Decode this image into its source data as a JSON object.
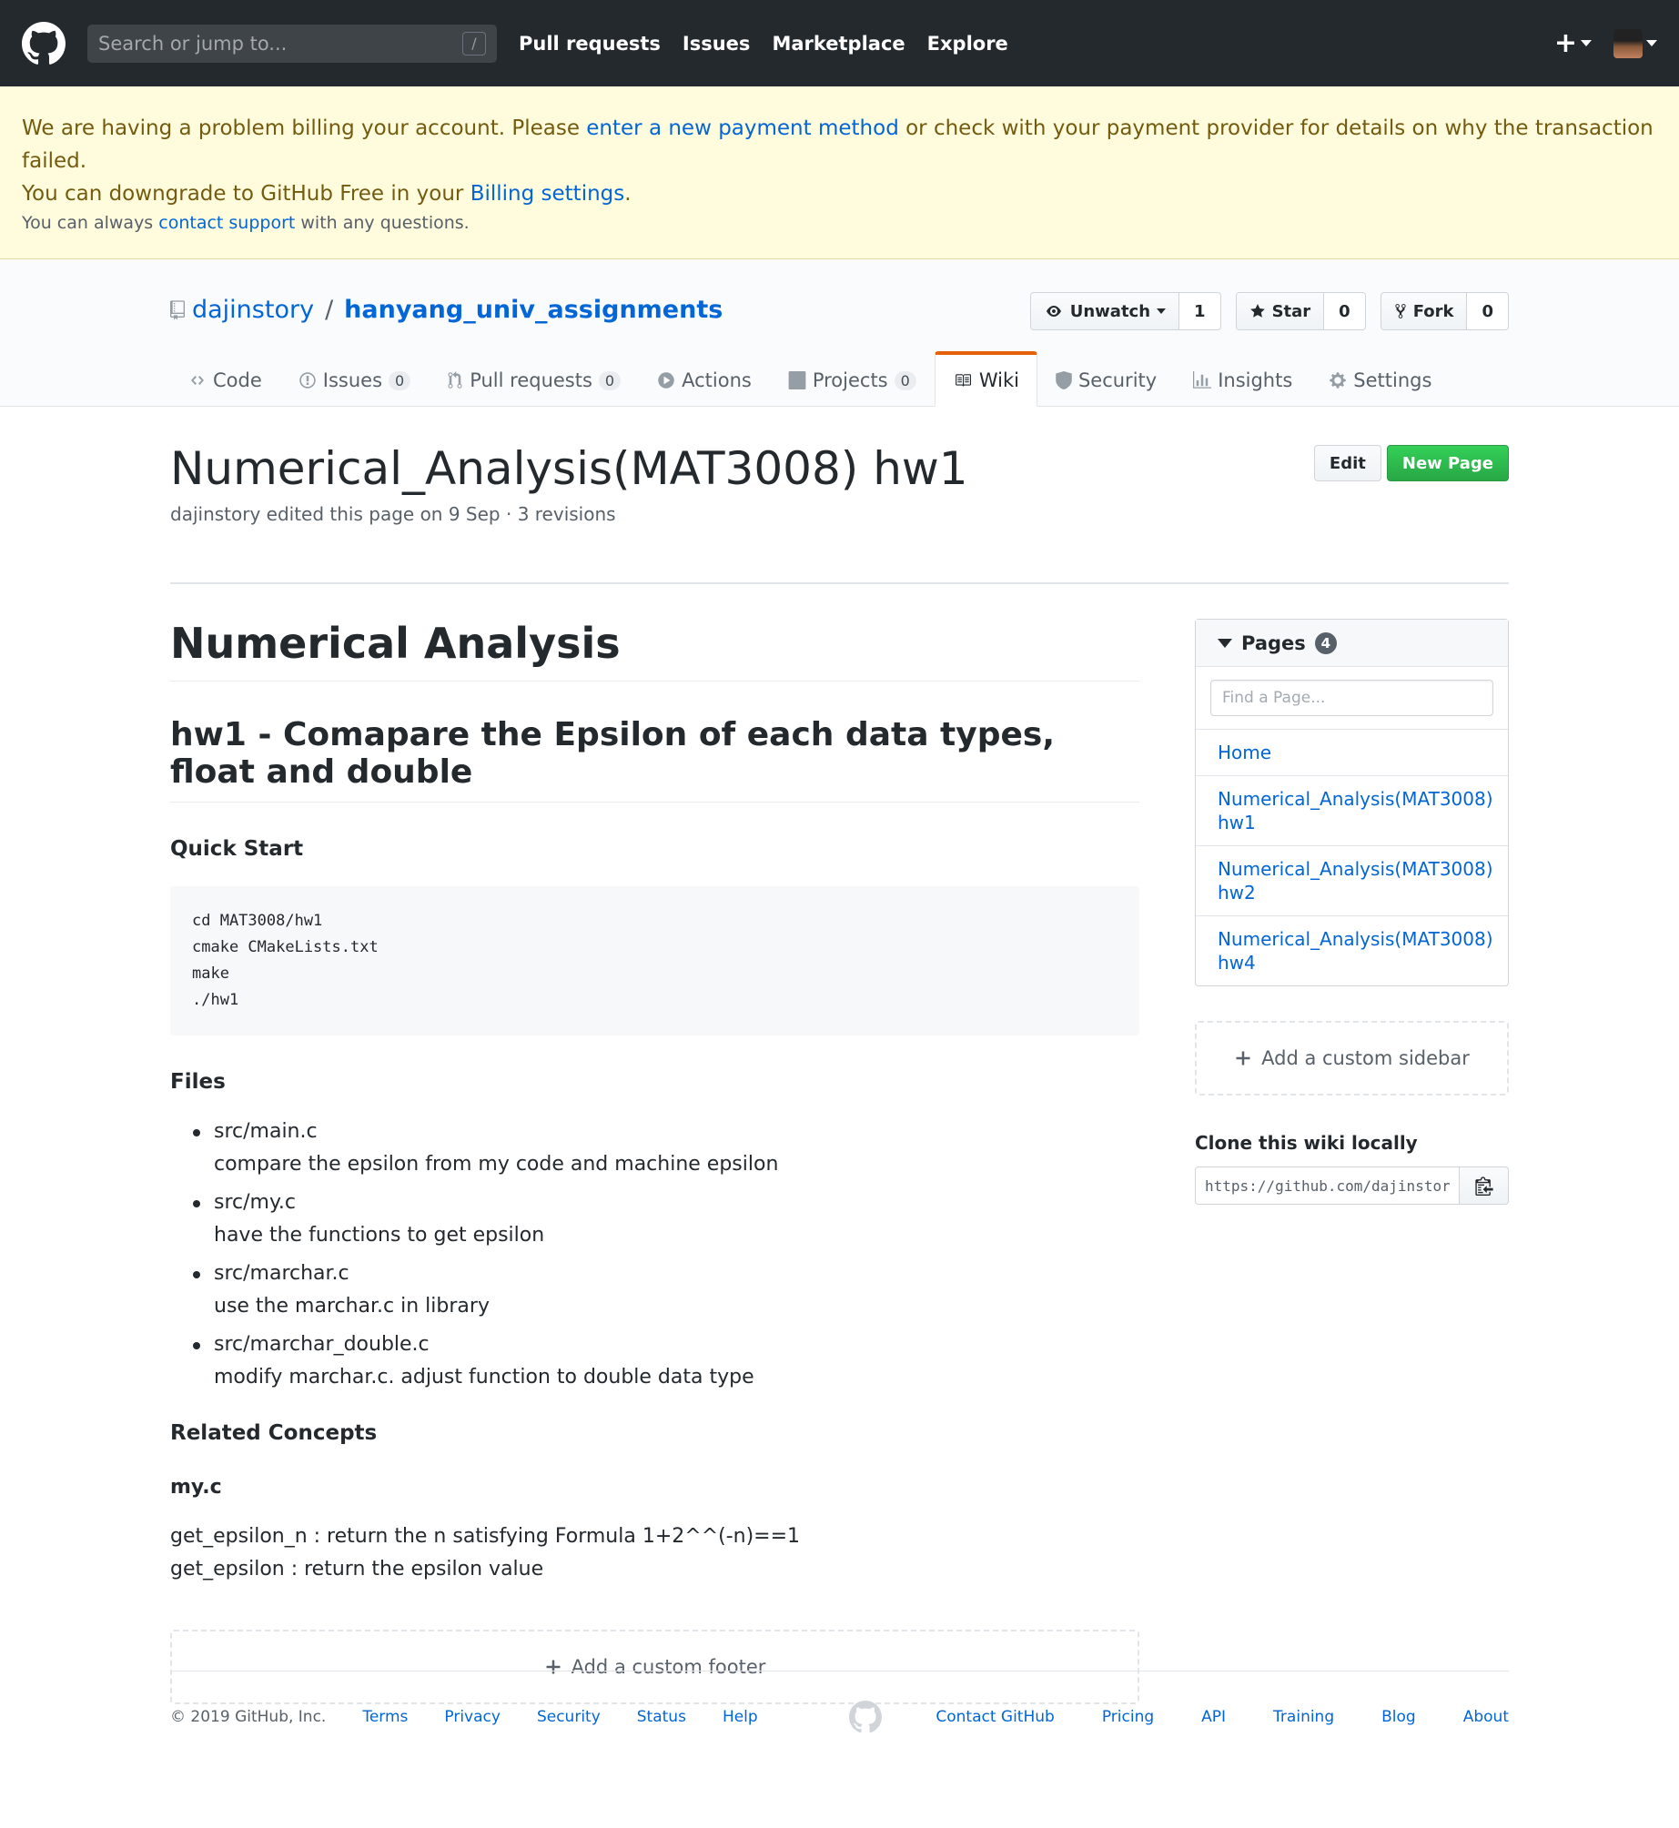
{
  "header": {
    "search_placeholder": "Search or jump to...",
    "slash_key": "/",
    "nav": [
      "Pull requests",
      "Issues",
      "Marketplace",
      "Explore"
    ],
    "new_symbol": "+"
  },
  "banner": {
    "line1_pre": "We are having a problem billing your account. Please ",
    "line1_link": "enter a new payment method",
    "line1_post": " or check with your payment provider for details on why the transaction failed.",
    "line2_pre": "You can downgrade to GitHub Free in your ",
    "line2_link": "Billing settings",
    "line2_post": ".",
    "line3_pre": "You can always ",
    "line3_link": "contact support",
    "line3_post": " with any questions."
  },
  "repo": {
    "owner": "dajinstory",
    "separator": "/",
    "name": "hanyang_univ_assignments",
    "watch_label": "Unwatch",
    "watch_count": "1",
    "star_label": "Star",
    "star_count": "0",
    "fork_label": "Fork",
    "fork_count": "0",
    "tabs": [
      {
        "label": "Code",
        "count": ""
      },
      {
        "label": "Issues",
        "count": "0"
      },
      {
        "label": "Pull requests",
        "count": "0"
      },
      {
        "label": "Actions",
        "count": ""
      },
      {
        "label": "Projects",
        "count": "0"
      },
      {
        "label": "Wiki",
        "count": ""
      },
      {
        "label": "Security",
        "count": ""
      },
      {
        "label": "Insights",
        "count": ""
      },
      {
        "label": "Settings",
        "count": ""
      }
    ]
  },
  "wiki": {
    "title": "Numerical_Analysis(MAT3008) hw1",
    "meta": "dajinstory edited this page on 9 Sep · 3 revisions",
    "edit_label": "Edit",
    "new_page_label": "New Page"
  },
  "content": {
    "h1": "Numerical Analysis",
    "h2": "hw1 - Comapare the Epsilon of each data types, float and double",
    "quick_start": "Quick Start",
    "code": "cd MAT3008/hw1\ncmake CMakeLists.txt\nmake\n./hw1",
    "files_heading": "Files",
    "files": [
      {
        "name": "src/main.c",
        "desc": "compare the epsilon from my code and machine epsilon"
      },
      {
        "name": "src/my.c",
        "desc": "have the functions to get epsilon"
      },
      {
        "name": "src/marchar.c",
        "desc": "use the marchar.c in library"
      },
      {
        "name": "src/marchar_double.c",
        "desc": "modify marchar.c. adjust function to double data type"
      }
    ],
    "related_heading": "Related Concepts",
    "myc_heading": "my.c",
    "line1": "get_epsilon_n : return the n satisfying Formula 1+2^^(-n)==1",
    "line2": "get_epsilon : return the epsilon value",
    "add_footer": "Add a custom footer"
  },
  "sidebar": {
    "pages_label": "Pages",
    "pages_count": "4",
    "find_placeholder": "Find a Page...",
    "pages": [
      "Home",
      "Numerical_Analysis(MAT3008) hw1",
      "Numerical_Analysis(MAT3008) hw2",
      "Numerical_Analysis(MAT3008) hw4"
    ],
    "add_sidebar": "Add a custom sidebar",
    "clone_heading": "Clone this wiki locally",
    "clone_url": "https://github.com/dajinstory/hanyang_univ_assignments.wiki.git"
  },
  "footer": {
    "copyright": "© 2019 GitHub, Inc.",
    "left_links": [
      "Terms",
      "Privacy",
      "Security",
      "Status",
      "Help"
    ],
    "right_links": [
      "Contact GitHub",
      "Pricing",
      "API",
      "Training",
      "Blog",
      "About"
    ]
  },
  "colors": {
    "header_bg": "#24292e",
    "banner_bg": "#fffbdd",
    "link": "#0366d6",
    "wiki_tab_accent": "#e36209",
    "primary_button": "#28a745"
  }
}
